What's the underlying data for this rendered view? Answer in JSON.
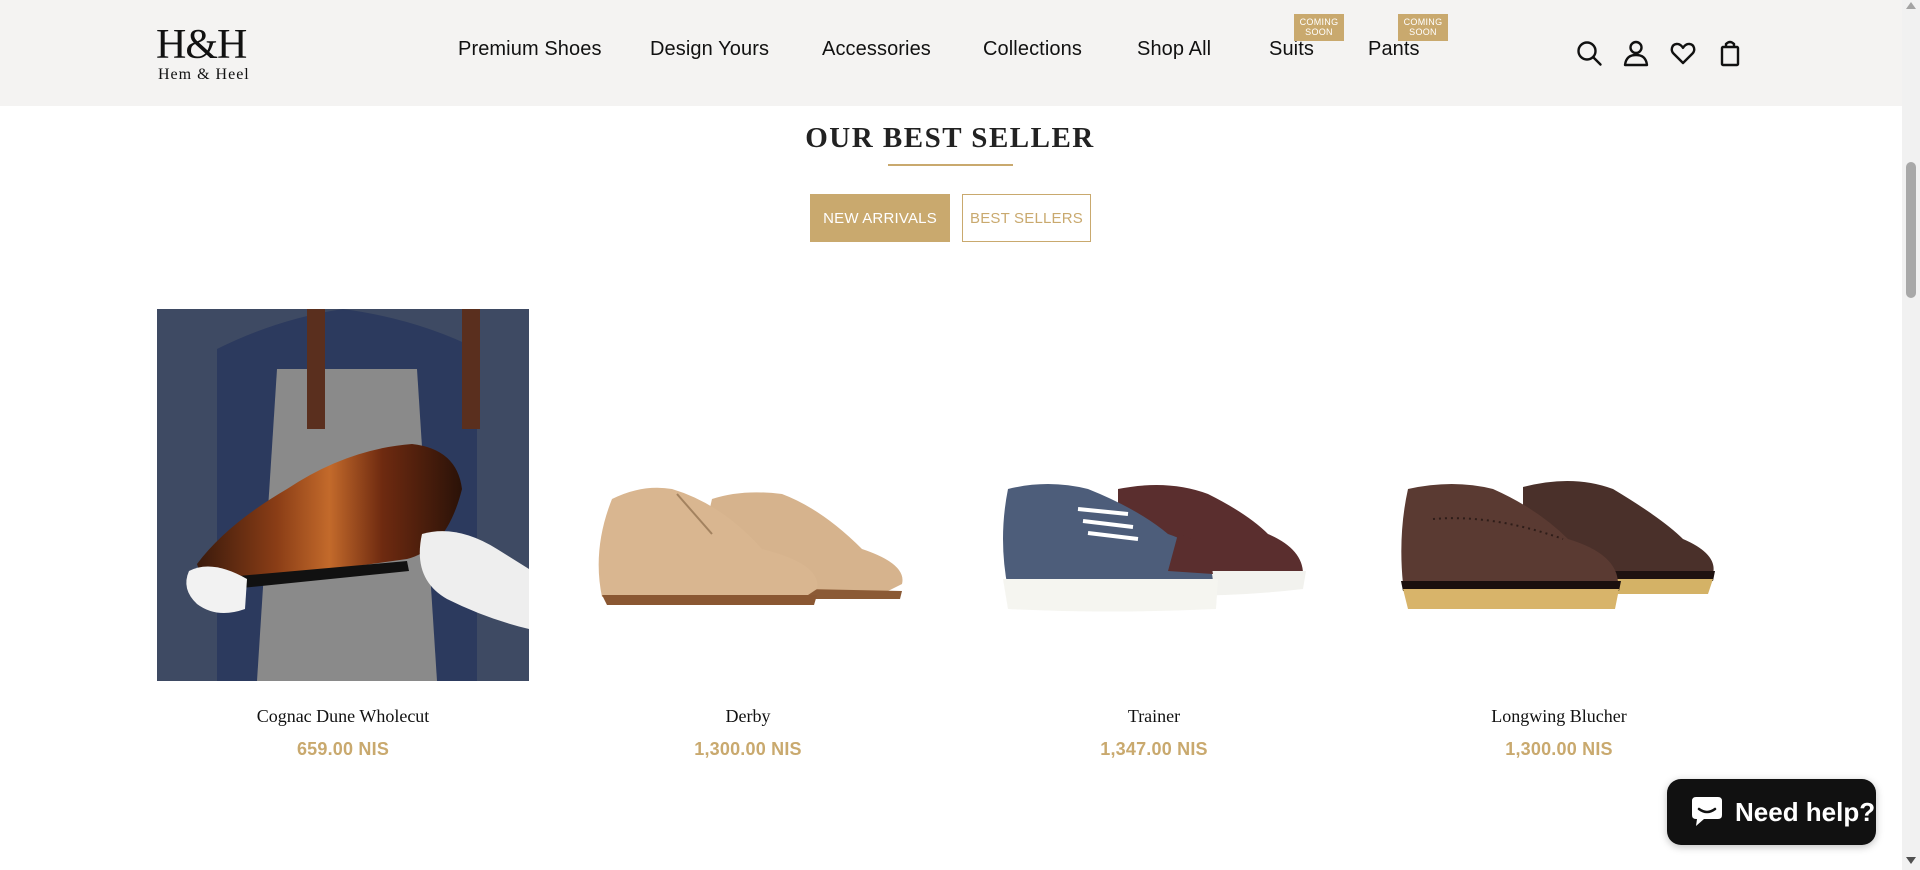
{
  "brand": {
    "mark": "H&H",
    "name": "Hem & Heel"
  },
  "nav": [
    {
      "label": "Premium Shoes"
    },
    {
      "label": "Design Yours"
    },
    {
      "label": "Accessories"
    },
    {
      "label": "Collections"
    },
    {
      "label": "Shop All"
    },
    {
      "label": "Suits",
      "badge": "COMING SOON"
    },
    {
      "label": "Pants",
      "badge": "COMING SOON"
    }
  ],
  "header_icons": [
    "search-icon",
    "account-icon",
    "wishlist-heart-icon",
    "cart-bag-icon"
  ],
  "section": {
    "title": "OUR BEST SELLER",
    "tabs": [
      {
        "label": "NEW ARRIVALS",
        "active": true
      },
      {
        "label": "BEST SELLERS",
        "active": false
      }
    ]
  },
  "products": [
    {
      "name": "Cognac Dune Wholecut",
      "price": "659.00 NIS"
    },
    {
      "name": "Derby",
      "price": "1,300.00 NIS"
    },
    {
      "name": "Trainer",
      "price": "1,347.00 NIS"
    },
    {
      "name": "Longwing Blucher",
      "price": "1,300.00 NIS"
    }
  ],
  "help_widget": {
    "label": "Need help?"
  },
  "colors": {
    "accent": "#c9a96e",
    "header_bg": "#f4f3f2",
    "text": "#111111",
    "help_bg": "#111111"
  }
}
